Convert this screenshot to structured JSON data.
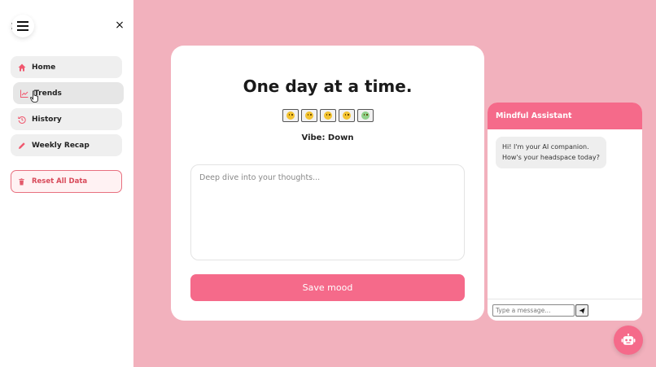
{
  "sidebar": {
    "items": [
      {
        "label": "Home",
        "icon": "home-icon"
      },
      {
        "label": "Trends",
        "icon": "trend-chart-icon"
      },
      {
        "label": "History",
        "icon": "history-icon"
      },
      {
        "label": "Weekly Recap",
        "icon": "pencil-icon"
      }
    ],
    "reset_label": "Reset All Data",
    "close_glyph": "×"
  },
  "main": {
    "title": "One day at a time.",
    "moods": [
      {
        "icon": "grinning-face-icon"
      },
      {
        "icon": "smiling-face-icon"
      },
      {
        "icon": "neutral-face-icon"
      },
      {
        "icon": "sad-face-icon"
      },
      {
        "icon": "crying-face-icon"
      }
    ],
    "vibe_text": "Vibe: Down",
    "thoughts_placeholder": "Deep dive into your thoughts...",
    "save_label": "Save mood"
  },
  "chat": {
    "title": "Mindful Assistant",
    "message": "Hi! I'm your AI companion. How's your headspace today?",
    "input_placeholder": "Type a message..."
  },
  "colors": {
    "background": "#f2b1bd",
    "accent": "#f56a8a",
    "danger": "#d84a5a"
  }
}
